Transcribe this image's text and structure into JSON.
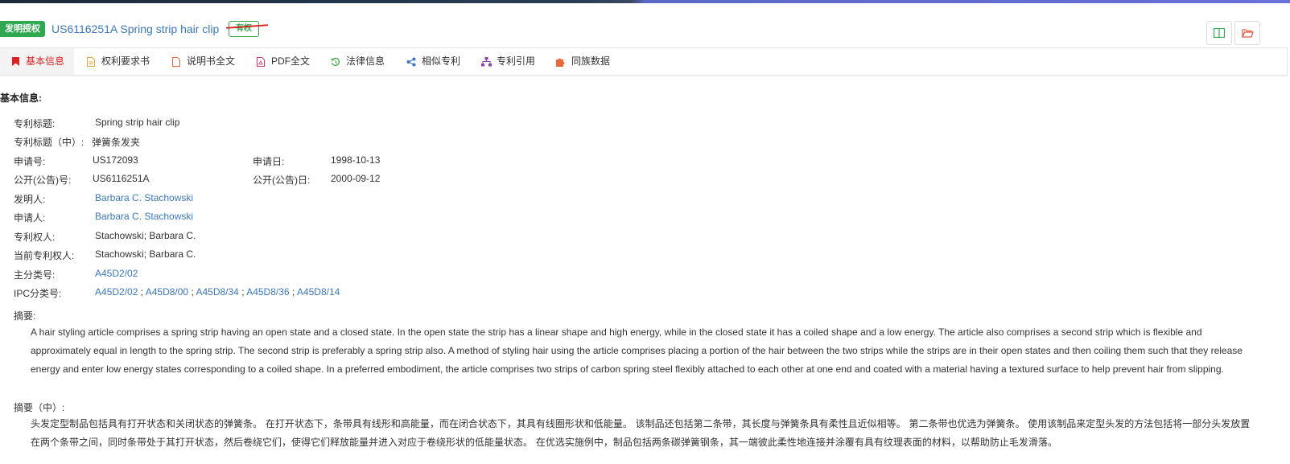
{
  "header": {
    "type_badge": "发明授权",
    "title": "US6116251A Spring strip hair clip",
    "status_badge": "有权",
    "brand_color": "#2fa84f",
    "link_color": "#3a78c0"
  },
  "tabs": [
    {
      "label": "基本信息",
      "icon": "bookmark-icon",
      "active": true
    },
    {
      "label": "权利要求书",
      "icon": "document-icon"
    },
    {
      "label": "说明书全文",
      "icon": "file-icon"
    },
    {
      "label": "PDF全文",
      "icon": "pdf-icon"
    },
    {
      "label": "法律信息",
      "icon": "history-icon"
    },
    {
      "label": "相似专利",
      "icon": "share-icon"
    },
    {
      "label": "专利引用",
      "icon": "sitemap-icon"
    },
    {
      "label": "同族数据",
      "icon": "puzzle-icon"
    }
  ],
  "basic": {
    "section_title": "基本信息:",
    "title_label": "专利标题:",
    "title_value": "Spring strip hair clip",
    "title_cn_label": "专利标题（中）:",
    "title_cn_value": "弹簧条发夹",
    "app_no_label": "申请号:",
    "app_no_value": "US172093",
    "app_date_label": "申请日:",
    "app_date_value": "1998-10-13",
    "pub_no_label": "公开(公告)号:",
    "pub_no_value": "US6116251A",
    "pub_date_label": "公开(公告)日:",
    "pub_date_value": "2000-09-12",
    "inventor_label": "发明人:",
    "inventor_value": "Barbara C. Stachowski",
    "applicant_label": "申请人:",
    "applicant_value": "Barbara C. Stachowski",
    "owner_label": "专利权人:",
    "owner_value": "Stachowski; Barbara C.",
    "current_owner_label": "当前专利权人:",
    "current_owner_value": "Stachowski; Barbara C.",
    "main_class_label": "主分类号:",
    "main_class_value": "A45D2/02",
    "ipc_label": "IPC分类号:",
    "ipc_values": [
      "A45D2/02",
      "A45D8/00",
      "A45D8/34",
      "A45D8/36",
      "A45D8/14"
    ],
    "ipc_sep": ";"
  },
  "abstract": {
    "label": "摘要:",
    "text": "A hair styling article comprises a spring strip having an open state and a closed state. In the open state the strip has a linear shape and high energy, while in the closed state it has a coiled shape and a low energy. The article also comprises a second strip which is flexible and approximately equal in length to the spring strip. The second strip is preferably a spring strip also. A method of styling hair using the article comprises placing a portion of the hair between the two strips while the strips are in their open states and then coiling them such that they release energy and enter low energy states corresponding to a coiled shape. In a preferred embodiment, the article comprises two strips of carbon spring steel flexibly attached to each other at one end and coated with a material having a textured surface to help prevent hair from slipping.",
    "cn_label": "摘要（中）:",
    "cn_text": "头发定型制品包括具有打开状态和关闭状态的弹簧条。 在打开状态下，条带具有线形和高能量，而在闭合状态下，其具有线圈形状和低能量。 该制品还包括第二条带，其长度与弹簧条具有柔性且近似相等。 第二条带也优选为弹簧条。 使用该制品来定型头发的方法包括将一部分头发放置在两个条带之间，同时条带处于其打开状态，然后卷绕它们，使得它们释放能量并进入对应于卷绕形状的低能量状态。 在优选实施例中，制品包括两条碳弹簧钢条，其一端彼此柔性地连接并涂覆有具有纹理表面的材料，以帮助防止毛发滑落。"
  }
}
